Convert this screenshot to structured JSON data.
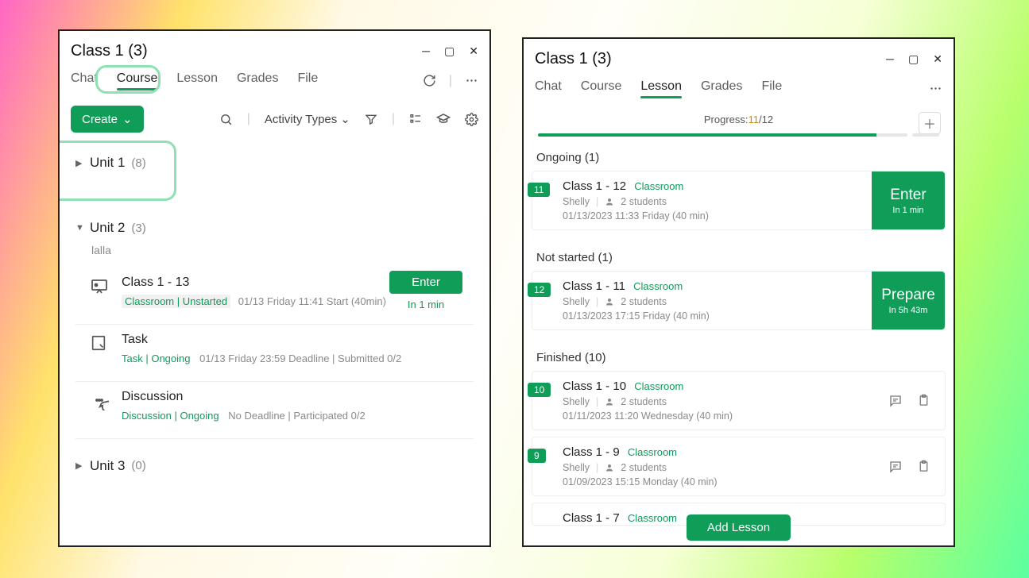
{
  "left": {
    "title": "Class 1 (3)",
    "tabs": [
      "Chat",
      "Course",
      "Lesson",
      "Grades",
      "File"
    ],
    "active_tab": "Course",
    "create_label": "Create",
    "activity_types_label": "Activity Types",
    "units": [
      {
        "caret": "▶",
        "name": "Unit 1",
        "count": "(8)"
      },
      {
        "caret": "▼",
        "name": "Unit 2",
        "count": "(3)",
        "desc": "lalla",
        "activities": [
          {
            "icon": "presentation",
            "title": "Class 1 - 13",
            "meta_green": "Classroom | Unstarted",
            "meta_rest": "01/13 Friday 11:41 Start (40min)",
            "cta": "Enter",
            "countdown": "In 1 min"
          },
          {
            "icon": "task",
            "title": "Task",
            "meta_green": "Task | Ongoing",
            "meta_rest": "01/13 Friday 23:59 Deadline  |  Submitted  0/2"
          },
          {
            "icon": "discussion",
            "title": "Discussion",
            "meta_green": "Discussion | Ongoing",
            "meta_rest": "No Deadline  |  Participated  0/2"
          }
        ]
      },
      {
        "caret": "▶",
        "name": "Unit 3",
        "count": "(0)"
      }
    ]
  },
  "right": {
    "title": "Class 1 (3)",
    "tabs": [
      "Chat",
      "Course",
      "Lesson",
      "Grades",
      "File"
    ],
    "active_tab": "Lesson",
    "progress_label": "Progress:",
    "progress_cur": "11",
    "progress_total": "/12",
    "add_lesson_label": "Add Lesson",
    "sections": [
      {
        "head": "Ongoing (1)",
        "items": [
          {
            "badge": "11",
            "title": "Class 1 - 12",
            "room": "Classroom",
            "teacher": "Shelly",
            "students": "2 students",
            "time": "01/13/2023 11:33 Friday (40 min)",
            "cta": "Enter",
            "cta_sub": "In 1 min"
          }
        ]
      },
      {
        "head": "Not started (1)",
        "items": [
          {
            "badge": "12",
            "title": "Class 1 - 11",
            "room": "Classroom",
            "teacher": "Shelly",
            "students": "2 students",
            "time": "01/13/2023 17:15 Friday (40 min)",
            "cta": "Prepare",
            "cta_sub": "In 5h 43m"
          }
        ]
      },
      {
        "head": "Finished (10)",
        "items": [
          {
            "badge": "10",
            "title": "Class 1 - 10",
            "room": "Classroom",
            "teacher": "Shelly",
            "students": "2 students",
            "time": "01/11/2023 11:20 Wednesday (40 min)",
            "icons": true
          },
          {
            "badge": "9",
            "title": "Class 1 - 9",
            "room": "Classroom",
            "teacher": "Shelly",
            "students": "2 students",
            "time": "01/09/2023 15:15 Monday (40 min)",
            "icons": true
          },
          {
            "badge": "",
            "title": "Class 1 - 7",
            "room": "Classroom",
            "teacher": "",
            "students": "",
            "time": "",
            "icons": false,
            "partial": true
          }
        ]
      }
    ]
  }
}
